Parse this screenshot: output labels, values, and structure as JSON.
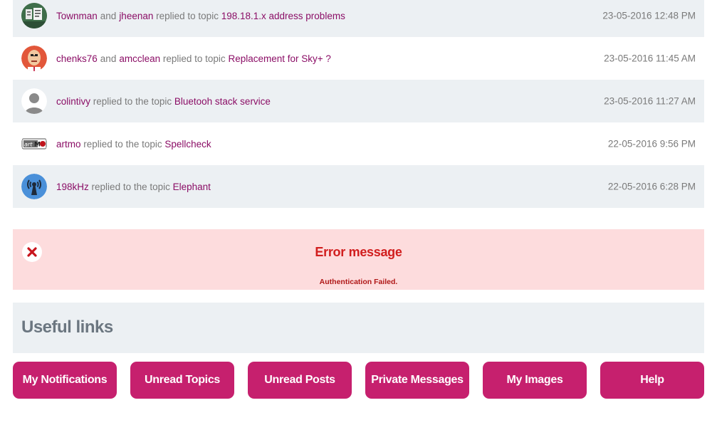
{
  "feed": [
    {
      "avatar": "townman-avatar",
      "users": [
        "Townman",
        "jheenan"
      ],
      "joiner": "and",
      "action": "replied to topic",
      "topic": "198.18.1.x address problems",
      "time": "23-05-2016 12:48 PM"
    },
    {
      "avatar": "chenks76-avatar",
      "users": [
        "chenks76",
        "amcclean"
      ],
      "joiner": "and",
      "action": "replied to topic",
      "topic": "Replacement for Sky+ ?",
      "time": "23-05-2016 11:45 AM"
    },
    {
      "avatar": "colintivy-avatar",
      "users": [
        "colintivy"
      ],
      "action": "replied to the topic",
      "topic": "Bluetooh stack service",
      "time": "23-05-2016 11:27 AM"
    },
    {
      "avatar": "artmo-avatar",
      "users": [
        "artmo"
      ],
      "action": "replied to the topic",
      "topic": "Spellcheck",
      "time": "22-05-2016 9:56 PM"
    },
    {
      "avatar": "198khz-avatar",
      "users": [
        "198kHz"
      ],
      "action": "replied to the topic",
      "topic": "Elephant",
      "time": "22-05-2016 6:28 PM"
    }
  ],
  "error": {
    "icon": "close-icon",
    "title": "Error message",
    "text": "Authentication Failed."
  },
  "useful_links": {
    "title": "Useful links",
    "buttons": [
      "My Notifications",
      "Unread Topics",
      "Unread Posts",
      "Private Messages",
      "My Images",
      "Help"
    ]
  },
  "colors": {
    "accent": "#c6206e",
    "link": "#8b0e66",
    "error_bg": "#fddcdd",
    "error_text": "#d11e1e",
    "panel_bg": "#ecf0f3"
  }
}
